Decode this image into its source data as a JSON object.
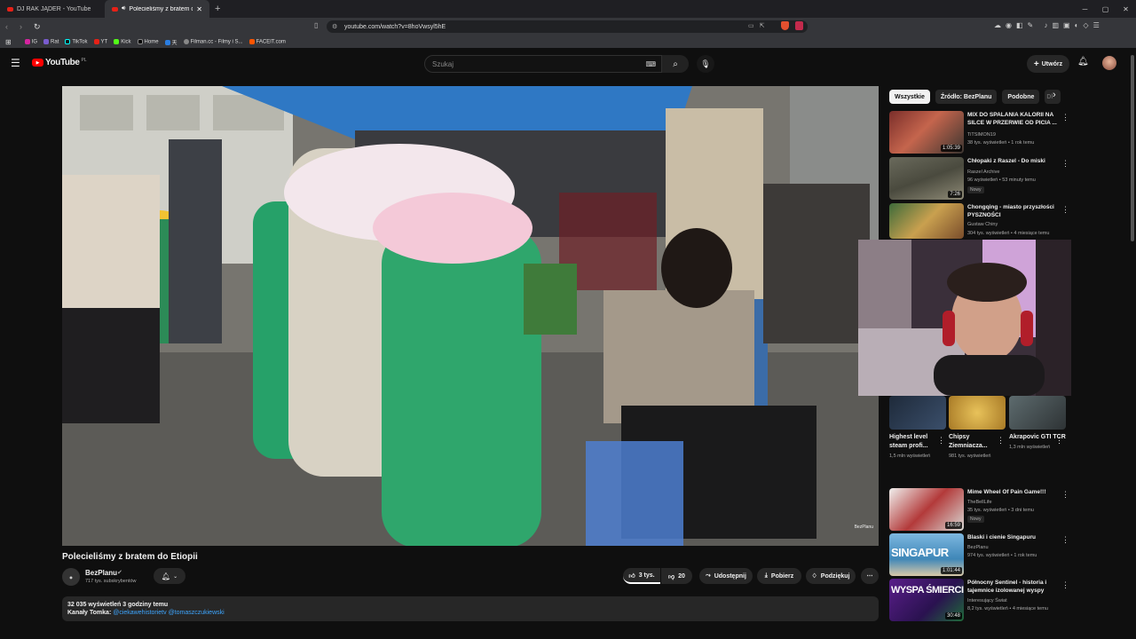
{
  "browser": {
    "tabs": [
      {
        "label": "DJ RAK JĄDER - YouTube",
        "active": false
      },
      {
        "label": "Polecieliśmy z bratem do Etio",
        "active": true
      }
    ],
    "url": "youtube.com/watch?v=8hoVwsyl5hE",
    "bookmarks": [
      "IG",
      "Rat",
      "TikTok",
      "YT",
      "Kick",
      "Home",
      "天",
      "Filman.cc - Filmy i S...",
      "FACEIT.com"
    ]
  },
  "yt": {
    "logo": "YouTube",
    "region": "PL",
    "search_placeholder": "Szukaj",
    "create_label": "Utwórz"
  },
  "video": {
    "title": "Polecieliśmy z bratem do Etiopii",
    "channel": "BezPlanu",
    "subscribers": "717 tys. subskrybentów",
    "likes": "3 tys.",
    "dislikes": "20",
    "share": "Udostępnij",
    "download": "Pobierz",
    "thanks": "Podziękuj",
    "watermark": "BezPlanu",
    "desc_stats": "32 035 wyświetleń  3 godziny temu",
    "desc_prefix": "Kanały Tomka: ",
    "desc_links": "@ciekawehistorietv @tomaszczukiewski"
  },
  "chips": [
    "Wszystkie",
    "Źródło: BezPlanu",
    "Podobne",
    "Dl"
  ],
  "recs": [
    {
      "title": "MIX DO SPALANIA KALORII NA SILCE W PRZERWIE OD PICIA ...",
      "channel": "TiTSIMON19",
      "meta": "38 tys. wyświetleń • 1 rok temu",
      "duration": "1:05:39",
      "badge": ""
    },
    {
      "title": "Chłopaki z Raszel - Do miski",
      "channel": "Raszel Archive",
      "meta": "96 wyświetleń • 53 minuty temu",
      "duration": "7:26",
      "badge": "Nowy"
    },
    {
      "title": "Chongqing - miasto przyszłości PYSZNOŚCI",
      "channel": "Gustaw Chiny",
      "meta": "304 tys. wyświetleń • 4 miesiące temu",
      "duration": "",
      "badge": ""
    },
    {
      "title": "Mime Wheel Of Pain Game!!!",
      "channel": "TheBellLife",
      "meta": "35 tys. wyświetleń • 3 dni temu",
      "duration": "16:59",
      "badge": "Nowy"
    },
    {
      "title": "Blaski i cienie Singapuru",
      "channel": "BezPlanu",
      "meta": "974 tys. wyświetleń • 1 rok temu",
      "duration": "1:01:44",
      "badge": ""
    },
    {
      "title": "Północny Sentinel - historia i tajemnice izolowanej wyspy",
      "channel": "Interesujący Świat",
      "meta": "8,2 tys. wyświetleń • 4 miesiące temu",
      "duration": "30:48",
      "badge": ""
    }
  ],
  "thumb_text": {
    "singapur": "SINGAPUR",
    "wyspa": "WYSPA ŚMIERCI"
  },
  "shorts": [
    {
      "title": "Highest level steam profi...",
      "views": "1,5 mln wyświetleń"
    },
    {
      "title": "Chipsy Ziemniacza...",
      "views": "981 tys. wyświetleń"
    },
    {
      "title": "Akrapovic GTI TCR",
      "views": "1,3 mln wyświetleń"
    }
  ]
}
